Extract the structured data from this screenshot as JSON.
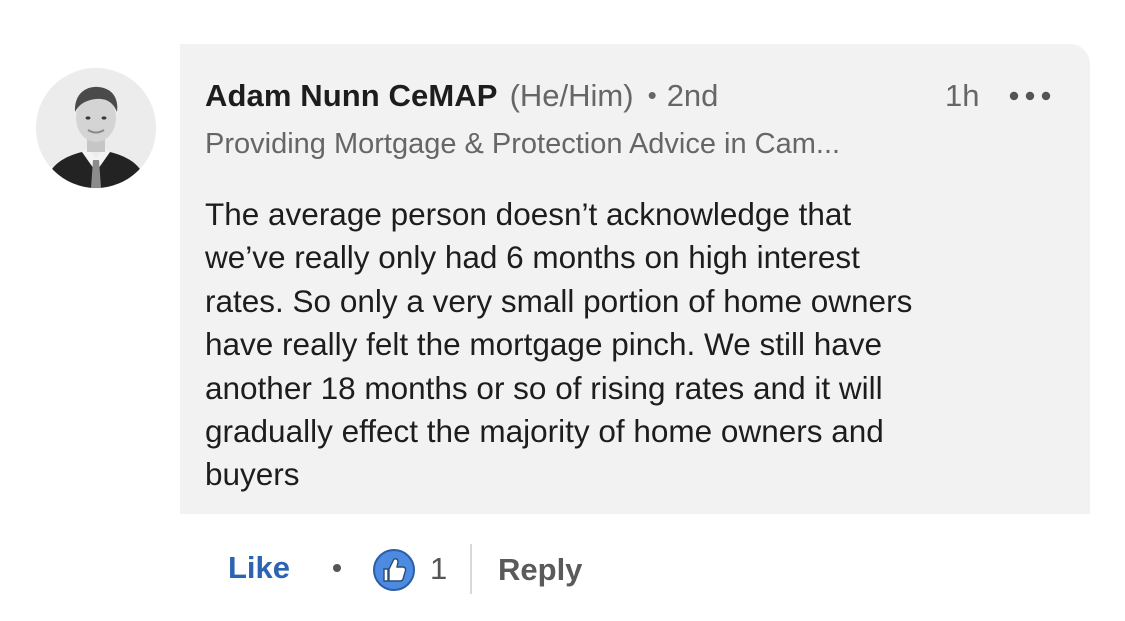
{
  "comment": {
    "author": {
      "name": "Adam Nunn CeMAP",
      "pronouns": "(He/Him)",
      "separator": "•",
      "degree": "2nd",
      "headline": "Providing Mortgage & Protection Advice in Cam..."
    },
    "timestamp": "1h",
    "text": "The average person doesn’t acknowledge that\nwe’ve really only had 6 months on high interest\nrates. So only a very small portion of home owners\nhave really felt the mortgage pinch. We still have\nanother 18 months or so of rising rates and it will\ngradually effect the majority of home owners and\nbuyers",
    "more_icon": "more-horizontal-icon",
    "avatar_icon": "profile-photo"
  },
  "actions": {
    "like_label": "Like",
    "reaction_icon": "like-thumbs-up-icon",
    "reaction_count": "1",
    "reply_label": "Reply"
  },
  "colors": {
    "bubble_background": "#f2f2f2",
    "like_blue": "#2c64b4",
    "secondary_text": "#666666"
  }
}
